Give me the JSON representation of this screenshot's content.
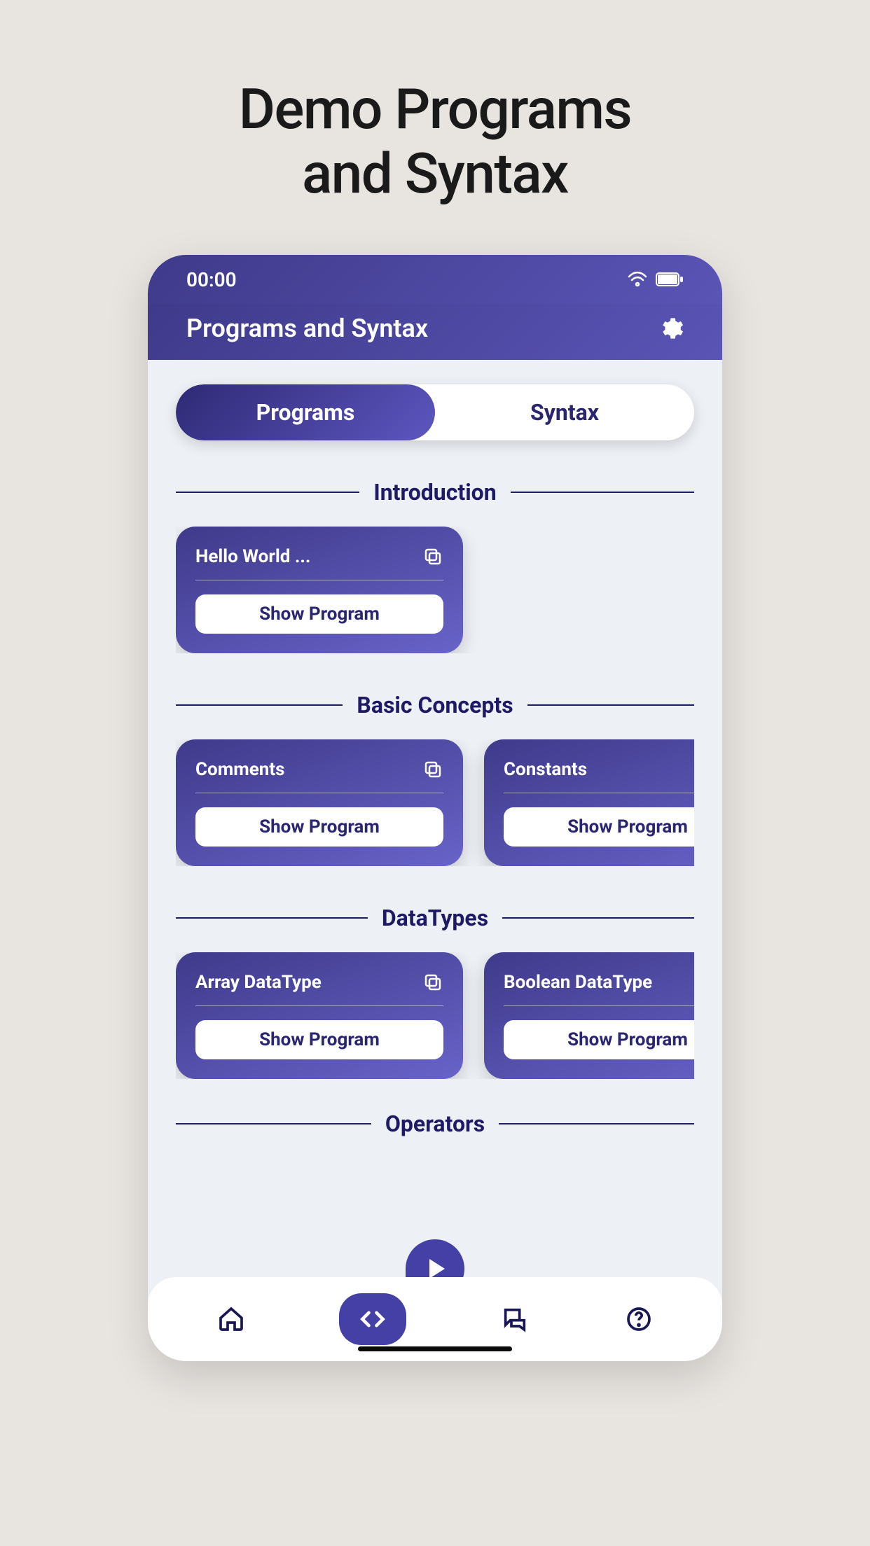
{
  "promo": {
    "title_line1": "Demo Programs",
    "title_line2": "and Syntax"
  },
  "status": {
    "time": "00:00"
  },
  "header": {
    "title": "Programs and Syntax"
  },
  "segments": {
    "programs": "Programs",
    "syntax": "Syntax"
  },
  "sections": [
    {
      "title": "Introduction",
      "cards": [
        {
          "title": "Hello World ...",
          "button": "Show Program"
        }
      ]
    },
    {
      "title": "Basic Concepts",
      "cards": [
        {
          "title": "Comments",
          "button": "Show Program"
        },
        {
          "title": "Constants",
          "button": "Show Program"
        }
      ]
    },
    {
      "title": "DataTypes",
      "cards": [
        {
          "title": "Array DataType",
          "button": "Show Program"
        },
        {
          "title": "Boolean DataType",
          "button": "Show Program"
        }
      ]
    },
    {
      "title": "Operators",
      "cards": []
    }
  ]
}
